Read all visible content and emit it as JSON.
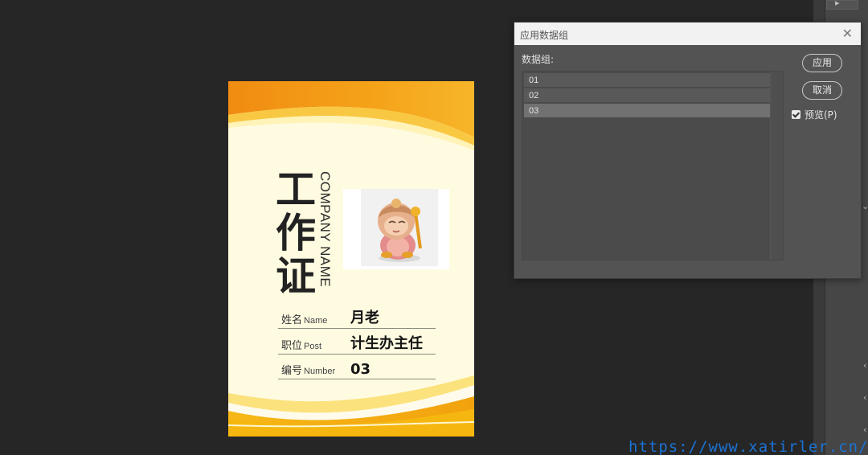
{
  "card": {
    "title_cn": "工作证",
    "company_name": "COMPANY NAME",
    "rows": [
      {
        "label_cn": "姓名",
        "label_en": "Name",
        "value": "月老"
      },
      {
        "label_cn": "职位",
        "label_en": "Post",
        "value": "计生办主任"
      },
      {
        "label_cn": "编号",
        "label_en": "Number",
        "value": "03"
      }
    ]
  },
  "dialog": {
    "title": "应用数据组",
    "close_icon": "close-icon",
    "group_label": "数据组:",
    "items": [
      "01",
      "02",
      "03"
    ],
    "selected_index": 2,
    "apply_label": "应用",
    "cancel_label": "取消",
    "preview_label": "预览(P)",
    "preview_checked": true
  },
  "watermark": "https://www.xatirler.cn/",
  "colors": {
    "canvas_bg": "#262626",
    "card_orange": "#f39a1a",
    "card_yellow": "#f7c21b",
    "card_cream": "#fffbe1",
    "watermark": "#1b73d6"
  }
}
